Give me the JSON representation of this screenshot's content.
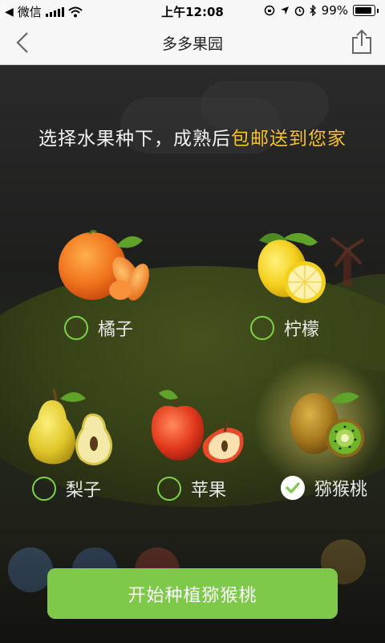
{
  "status_bar": {
    "carrier": "微信",
    "time": "上午12:08",
    "battery": "99%"
  },
  "nav": {
    "title": "多多果园"
  },
  "headline": {
    "prefix": "选择水果种下，成熟后",
    "highlight": "包邮送到您家"
  },
  "fruits": [
    {
      "label": "橘子",
      "selected": false,
      "icon": "tangerine-icon"
    },
    {
      "label": "柠檬",
      "selected": false,
      "icon": "lemon-icon"
    },
    {
      "label": "梨子",
      "selected": false,
      "icon": "pear-icon"
    },
    {
      "label": "苹果",
      "selected": false,
      "icon": "apple-icon"
    },
    {
      "label": "猕猴桃",
      "selected": true,
      "icon": "kiwi-icon"
    }
  ],
  "cta": {
    "label": "开始种植猕猴桃"
  },
  "colors": {
    "accent_green": "#7ec84a",
    "highlight_yellow": "#f5c12c",
    "radio_border": "#7fd14b"
  }
}
